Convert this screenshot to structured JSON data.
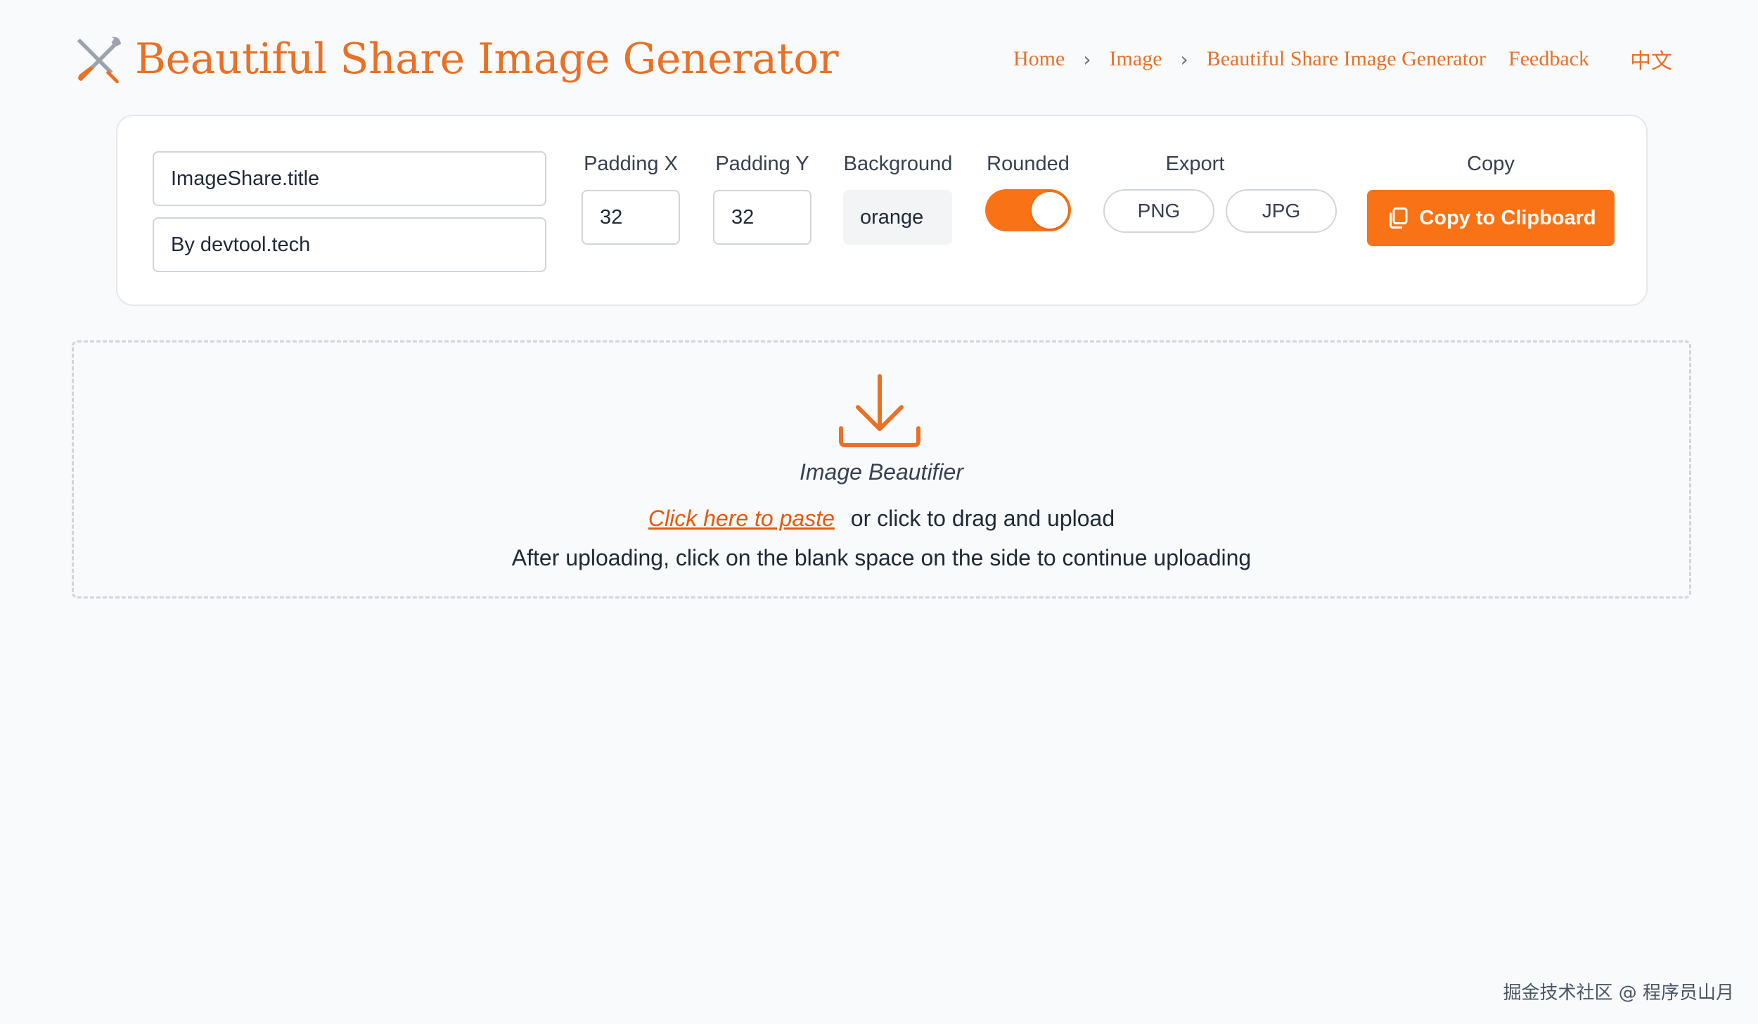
{
  "header": {
    "app_title": "Beautiful Share Image Generator",
    "logo_icon": "tools-icon",
    "accent_color": "#ea7026"
  },
  "nav": {
    "items": [
      {
        "label": "Home"
      },
      {
        "label": "Image"
      },
      {
        "label": "Beautiful Share Image Generator"
      }
    ],
    "separator": "›",
    "feedback": "Feedback",
    "language": "中文"
  },
  "controls": {
    "title_input": {
      "value": "ImageShare.title"
    },
    "subtitle_input": {
      "value": "By devtool.tech"
    },
    "padding_x": {
      "label": "Padding X",
      "value": "32"
    },
    "padding_y": {
      "label": "Padding Y",
      "value": "32"
    },
    "background": {
      "label": "Background",
      "value": "orange"
    },
    "rounded": {
      "label": "Rounded",
      "checked": true
    },
    "export": {
      "label": "Export",
      "png_label": "PNG",
      "jpg_label": "JPG"
    },
    "copy": {
      "label": "Copy",
      "button_label": "Copy to Clipboard",
      "icon": "copy-icon",
      "color": "#f97316"
    }
  },
  "dropzone": {
    "icon": "download-icon",
    "title": "Image Beautifier",
    "paste_link": "Click here to paste",
    "drag_text": "or click to drag and upload",
    "hint": "After uploading, click on the blank space on the side to continue uploading"
  },
  "watermark": "掘金技术社区 @ 程序员山月"
}
